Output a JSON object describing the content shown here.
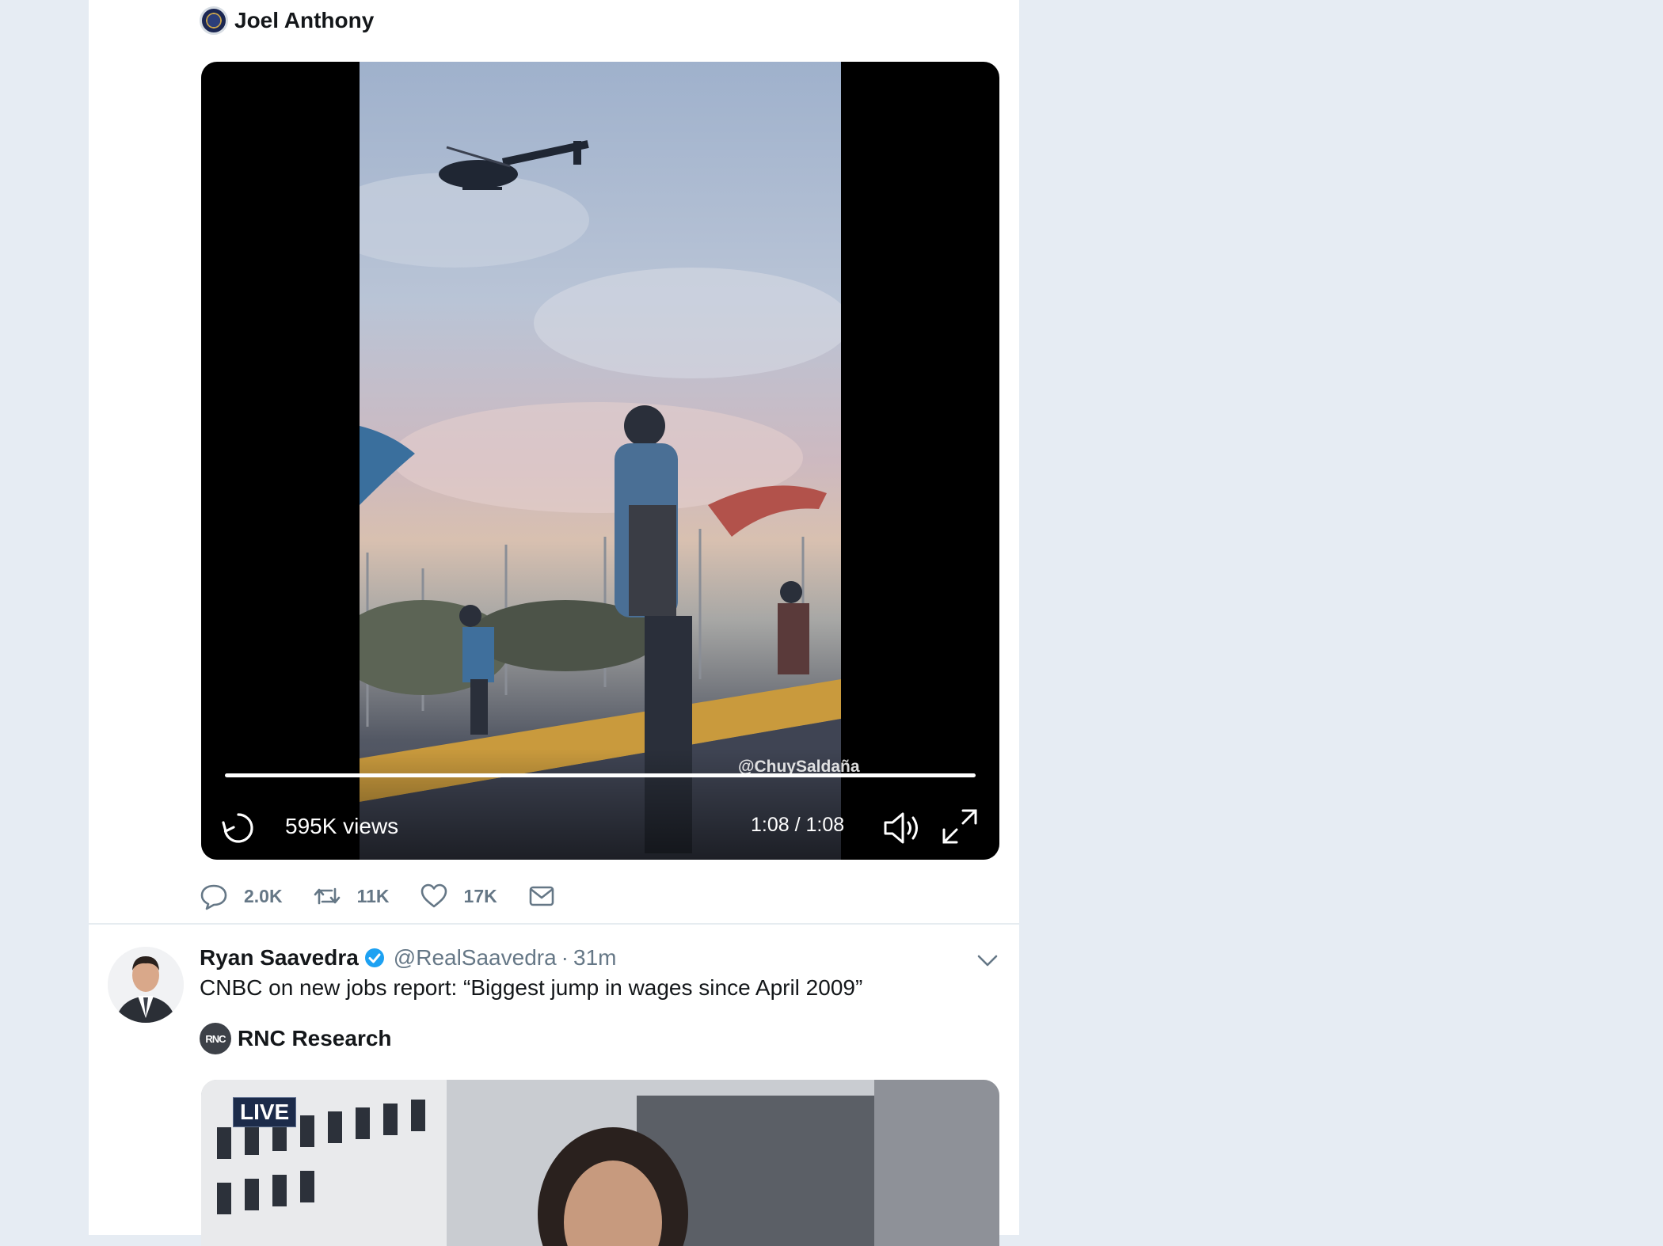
{
  "tweet1": {
    "quoted_user": "Joel Anthony",
    "video": {
      "watermark": "@ChuySaldaña",
      "views": "595K views",
      "time": "1:08 / 1:08",
      "progress_percent": 100
    },
    "actions": {
      "replies": "2.0K",
      "retweets": "11K",
      "likes": "17K"
    }
  },
  "tweet2": {
    "author_name": "Ryan Saavedra",
    "handle": "@RealSaavedra",
    "separator": "·",
    "time": "31m",
    "text": "CNBC on new jobs report: “Biggest jump in wages since April 2009”",
    "quoted_user": "RNC Research",
    "quoted_avatar_text": "RNC",
    "media_badge": "LIVE"
  },
  "colors": {
    "background": "#e6ecf3",
    "card": "#ffffff",
    "muted": "#657786",
    "verified": "#1da1f2"
  },
  "icons": [
    "replay-icon",
    "volume-icon",
    "fullscreen-icon",
    "reply-icon",
    "retweet-icon",
    "like-icon",
    "dm-icon",
    "verified-icon",
    "chevron-down-icon"
  ]
}
